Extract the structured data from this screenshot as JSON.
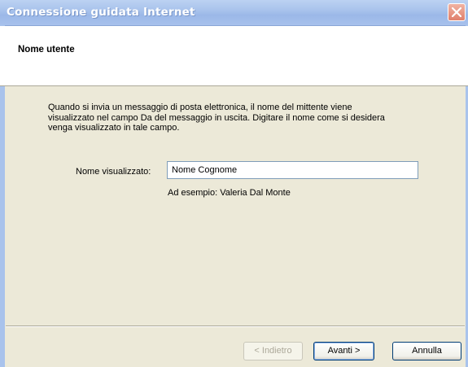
{
  "window": {
    "title": "Connessione guidata Internet"
  },
  "header": {
    "title": "Nome utente"
  },
  "content": {
    "description_lines": [
      "Quando si invia un messaggio di posta elettronica, il nome del mittente viene",
      "visualizzato nel campo Da del messaggio in uscita. Digitare il nome come si desidera",
      "venga visualizzato in tale campo."
    ],
    "display_name_label": "Nome visualizzato:",
    "display_name_value": "Nome Cognome",
    "example_text": "Ad esempio: Valeria Dal Monte"
  },
  "buttons": {
    "back_label": "< Indietro",
    "next_label": "Avanti >",
    "cancel_label": "Annulla"
  },
  "icons": {
    "close": "close-icon"
  },
  "colors": {
    "titlebar": "#a9c3ec",
    "close_button": "#e0806c",
    "dialog_bg": "#ece9d8"
  }
}
